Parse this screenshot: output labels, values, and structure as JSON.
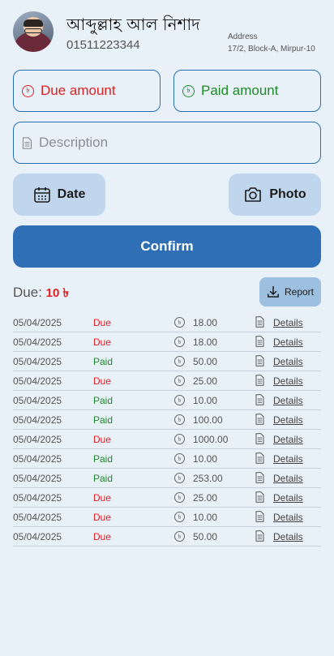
{
  "profile": {
    "name": "আব্দুল্লাহ আল নিশাদ",
    "phone": "01511223344",
    "address_label": "Address",
    "address": "17/2, Block-A, Mirpur-10"
  },
  "form": {
    "currency_symbol": "৳",
    "due_placeholder": "Due amount",
    "paid_placeholder": "Paid amount",
    "description_placeholder": "Description",
    "date_label": "Date",
    "photo_label": "Photo",
    "confirm_label": "Confirm"
  },
  "summary": {
    "due_label": "Due",
    "separator": ":",
    "due_value": "10 ৳",
    "report_label": "Report"
  },
  "colors": {
    "due": "#e02020",
    "paid": "#1f8a2a",
    "accent": "#2e6fb5"
  },
  "transactions": [
    {
      "date": "05/04/2025",
      "status": "Due",
      "amount": "18.00",
      "link": "Details"
    },
    {
      "date": "05/04/2025",
      "status": "Due",
      "amount": "18.00",
      "link": "Details"
    },
    {
      "date": "05/04/2025",
      "status": "Paid",
      "amount": "50.00",
      "link": "Details"
    },
    {
      "date": "05/04/2025",
      "status": "Due",
      "amount": "25.00",
      "link": "Details"
    },
    {
      "date": "05/04/2025",
      "status": "Paid",
      "amount": "10.00",
      "link": "Details"
    },
    {
      "date": "05/04/2025",
      "status": "Paid",
      "amount": "100.00",
      "link": "Details"
    },
    {
      "date": "05/04/2025",
      "status": "Due",
      "amount": "1000.00",
      "link": "Details"
    },
    {
      "date": "05/04/2025",
      "status": "Paid",
      "amount": "10.00",
      "link": "Details"
    },
    {
      "date": "05/04/2025",
      "status": "Paid",
      "amount": "253.00",
      "link": "Details"
    },
    {
      "date": "05/04/2025",
      "status": "Due",
      "amount": "25.00",
      "link": "Details"
    },
    {
      "date": "05/04/2025",
      "status": "Due",
      "amount": "10.00",
      "link": "Details"
    },
    {
      "date": "05/04/2025",
      "status": "Due",
      "amount": "50.00",
      "link": "Details"
    }
  ]
}
